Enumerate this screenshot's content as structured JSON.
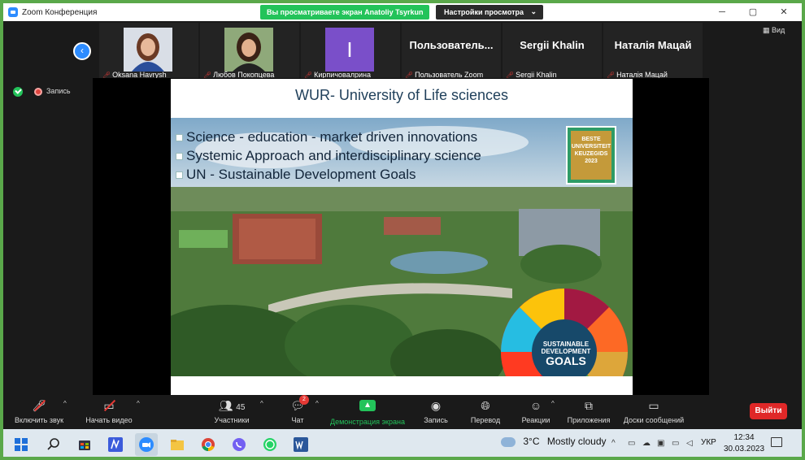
{
  "window": {
    "title": "Zoom Конференция",
    "share_banner": "Вы просматриваете экран Anatoliy Tsyrkun",
    "view_options": "Настройки просмотра",
    "minimize": "─",
    "maximize": "▢",
    "close": "✕"
  },
  "gallery": {
    "view_label": "Вид",
    "tiles": [
      {
        "name": "Oksana Havrysh",
        "big": ""
      },
      {
        "name": "Любов Покопцева",
        "big": ""
      },
      {
        "name": "Кирпичовалрина",
        "big": "I"
      },
      {
        "name": "Пользователь Zoom",
        "big": "Пользователь..."
      },
      {
        "name": "Sergii Khalin",
        "big": "Sergii Khalin"
      },
      {
        "name": "Наталія Мацай",
        "big": "Наталія Мацай"
      }
    ]
  },
  "recording": {
    "label": "Запись"
  },
  "slide": {
    "title": "WUR- University of Life sciences",
    "bullets": [
      "Science - education - market driven innovations",
      "Systemic Approach and interdisciplinary science",
      "UN - Sustainable Development Goals"
    ],
    "badge": {
      "line1": "BESTE",
      "line2": "UNIVERSITEIT",
      "line3": "KEUZEGIDS",
      "line4": "2023"
    },
    "sdg": {
      "line1": "SUSTAINABLE",
      "line2": "DEVELOPMENT",
      "line3": "GOALS"
    }
  },
  "toolbar": {
    "audio": "Включить звук",
    "video": "Начать видео",
    "participants": "Участники",
    "participants_count": "45",
    "chat": "Чат",
    "chat_badge": "2",
    "share": "Демонстрация экрана",
    "record": "Запись",
    "translate": "Перевод",
    "reactions": "Реакции",
    "apps": "Приложения",
    "whiteboard": "Доски сообщений",
    "leave": "Выйти"
  },
  "taskbar": {
    "weather_temp": "3°C",
    "weather_text": "Mostly cloudy",
    "lang": "УКР",
    "time": "12:34",
    "date": "30.03.2023",
    "zoom_label": "zoom"
  },
  "colors": {
    "frame": "#5aa84a",
    "zoom_blue": "#2d8cff",
    "share_green": "#23c35a",
    "leave_red": "#e02828"
  }
}
